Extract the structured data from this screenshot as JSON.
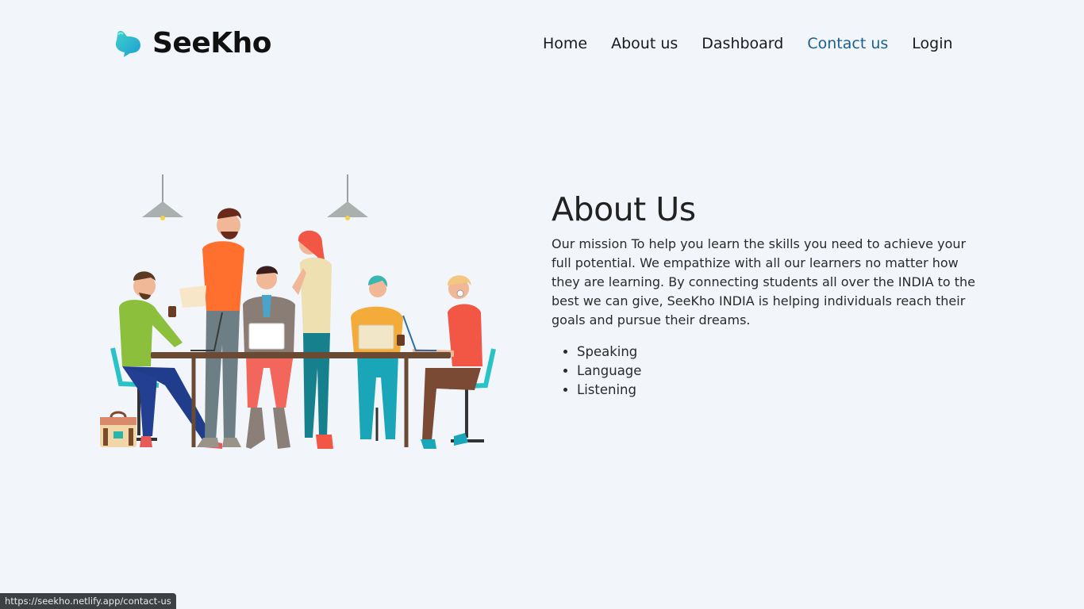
{
  "brand": {
    "name": "SeeKho",
    "logo_icon": "chat-bubble-logo-icon"
  },
  "nav": {
    "items": [
      {
        "label": "Home",
        "active": false
      },
      {
        "label": "About us",
        "active": false
      },
      {
        "label": "Dashboard",
        "active": false
      },
      {
        "label": "Contact us",
        "active": true
      },
      {
        "label": "Login",
        "active": false
      }
    ]
  },
  "about": {
    "title": "About Us",
    "description": "Our mission To help you learn the skills you need to achieve your full potential. We empathize with all our learners no matter how they are learning. By connecting students all over the INDIA to the best we can give, SeeKho INDIA is helping individuals reach their goals and pursue their dreams.",
    "skills": [
      "Speaking",
      "Language",
      "Listening"
    ]
  },
  "status_bar": {
    "url": "https://seekho.netlify.app/contact-us"
  },
  "colors": {
    "background": "#f2f5fa",
    "active_link": "#1b5f8f",
    "logo_teal": "#2bbcc9"
  }
}
